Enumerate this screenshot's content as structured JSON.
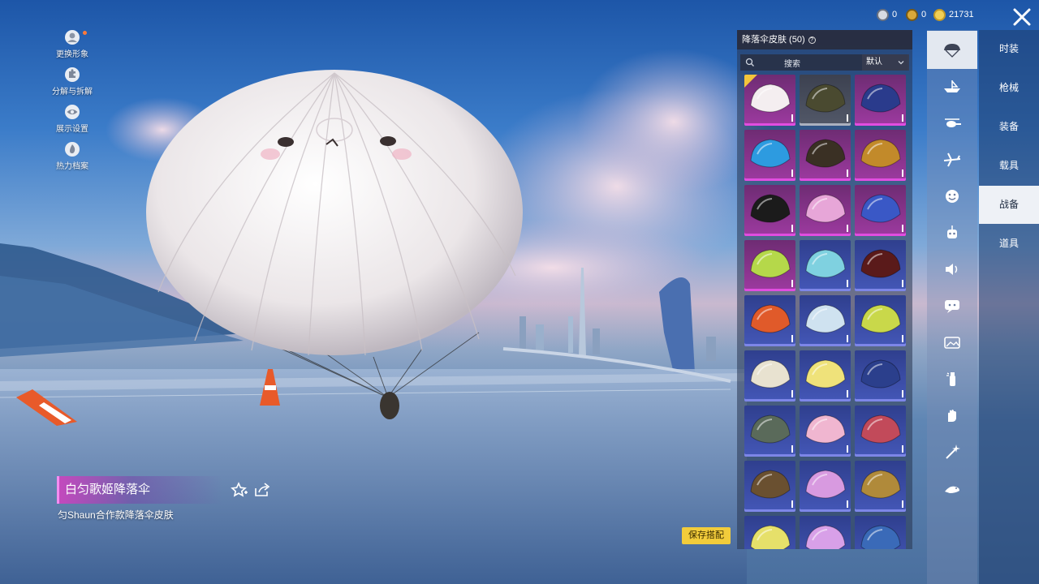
{
  "currency": [
    {
      "icon": "currency-1-icon",
      "value": "0"
    },
    {
      "icon": "currency-2-icon",
      "value": "0"
    },
    {
      "icon": "gold-coin-icon",
      "value": "21731"
    }
  ],
  "left_menu": [
    {
      "icon": "avatar-icon",
      "label": "更换形象"
    },
    {
      "icon": "puzzle-icon",
      "label": "分解与拆解"
    },
    {
      "icon": "eye-icon",
      "label": "展示设置"
    },
    {
      "icon": "flame-icon",
      "label": "热力档案"
    }
  ],
  "item": {
    "name": "白匀歌姬降落伞",
    "desc": "匀Shaun合作款降落伞皮肤"
  },
  "save_button": "保存搭配",
  "panel": {
    "title": "降落伞皮肤 (50)",
    "help": "?",
    "search_placeholder": "搜索",
    "sort_label": "默认"
  },
  "grid_items": [
    {
      "rarity": "purple",
      "color": "#f4eef0",
      "selected": true
    },
    {
      "rarity": "grey",
      "color": "#4a4a30",
      "selected": false
    },
    {
      "rarity": "purple",
      "color": "#2a3b8c",
      "selected": false
    },
    {
      "rarity": "purple",
      "color": "#2d9be0",
      "selected": false
    },
    {
      "rarity": "purple",
      "color": "#3a3024",
      "selected": false
    },
    {
      "rarity": "purple",
      "color": "#c28a2a",
      "selected": false
    },
    {
      "rarity": "purple",
      "color": "#1b1b1b",
      "selected": false
    },
    {
      "rarity": "purple",
      "color": "#e7a6d8",
      "selected": false
    },
    {
      "rarity": "purple",
      "color": "#3a58c6",
      "selected": false
    },
    {
      "rarity": "purple",
      "color": "#b5d84a",
      "selected": false
    },
    {
      "rarity": "blue",
      "color": "#7fd1e0",
      "selected": false
    },
    {
      "rarity": "blue",
      "color": "#5a1a1a",
      "selected": false
    },
    {
      "rarity": "blue",
      "color": "#e05a2a",
      "selected": false
    },
    {
      "rarity": "blue",
      "color": "#cfe2f0",
      "selected": false
    },
    {
      "rarity": "blue",
      "color": "#c9d84a",
      "selected": false
    },
    {
      "rarity": "blue",
      "color": "#e8e2d0",
      "selected": false
    },
    {
      "rarity": "blue",
      "color": "#efe27a",
      "selected": false
    },
    {
      "rarity": "blue",
      "color": "#2b3f8c",
      "selected": false
    },
    {
      "rarity": "blue",
      "color": "#5a6a5a",
      "selected": false
    },
    {
      "rarity": "blue",
      "color": "#f0b6d0",
      "selected": false
    },
    {
      "rarity": "blue",
      "color": "#c24a5a",
      "selected": false
    },
    {
      "rarity": "blue",
      "color": "#6a5030",
      "selected": false
    },
    {
      "rarity": "blue",
      "color": "#d89ae0",
      "selected": false
    },
    {
      "rarity": "blue",
      "color": "#b08a3a",
      "selected": false
    },
    {
      "rarity": "blue",
      "color": "#e6e06a",
      "selected": false
    },
    {
      "rarity": "blue",
      "color": "#d8a0e8",
      "selected": false
    },
    {
      "rarity": "blue",
      "color": "#3a6ab8",
      "selected": false
    }
  ],
  "categories": [
    {
      "icon": "parachute-icon",
      "active": true
    },
    {
      "icon": "boat-icon",
      "active": false
    },
    {
      "icon": "helicopter-icon",
      "active": false
    },
    {
      "icon": "plane-icon",
      "active": false
    },
    {
      "icon": "emote-face-icon",
      "active": false
    },
    {
      "icon": "robot-icon",
      "active": false
    },
    {
      "icon": "speaker-icon",
      "active": false
    },
    {
      "icon": "chat-bubble-icon",
      "active": false
    },
    {
      "icon": "photo-icon",
      "active": false
    },
    {
      "icon": "spray-icon",
      "active": false
    },
    {
      "icon": "hand-icon",
      "active": false
    },
    {
      "icon": "sparkle-wand-icon",
      "active": false
    },
    {
      "icon": "bird-icon",
      "active": false
    }
  ],
  "tabs": [
    {
      "label": "时装",
      "active": false
    },
    {
      "label": "枪械",
      "active": false
    },
    {
      "label": "装备",
      "active": false
    },
    {
      "label": "载具",
      "active": false
    },
    {
      "label": "战备",
      "active": true
    },
    {
      "label": "道具",
      "active": false
    }
  ]
}
